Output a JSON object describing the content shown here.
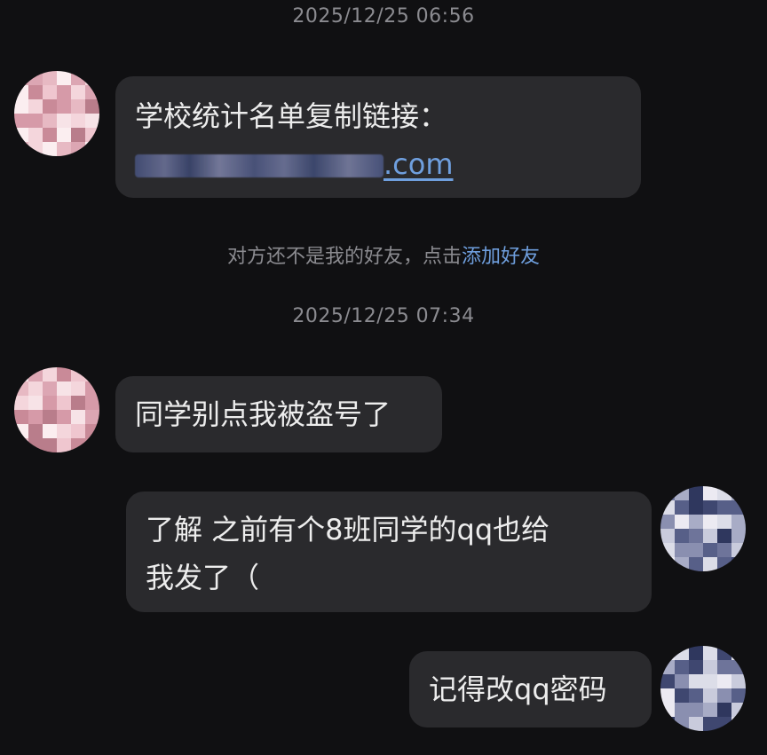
{
  "conversation": {
    "timestamps": [
      "2025/12/25 06:56",
      "2025/12/25 07:34"
    ],
    "messages": [
      {
        "sender": "other",
        "line1": "学校统计名单复制链接：",
        "link_suffix": ".com"
      },
      {
        "sender": "other",
        "text": "同学别点我被盗号了"
      },
      {
        "sender": "self",
        "line1": "了解 之前有个8班同学的qq也给",
        "line2": "我发了（"
      },
      {
        "sender": "self",
        "text": "记得改qq密码"
      }
    ],
    "system_note": {
      "text": "对方还不是我的好友，点击",
      "link": "添加好友"
    }
  },
  "colors": {
    "background": "#101012",
    "bubble": "#2a2a2d",
    "link": "#6f9fde",
    "muted_text": "#8b8b90"
  }
}
